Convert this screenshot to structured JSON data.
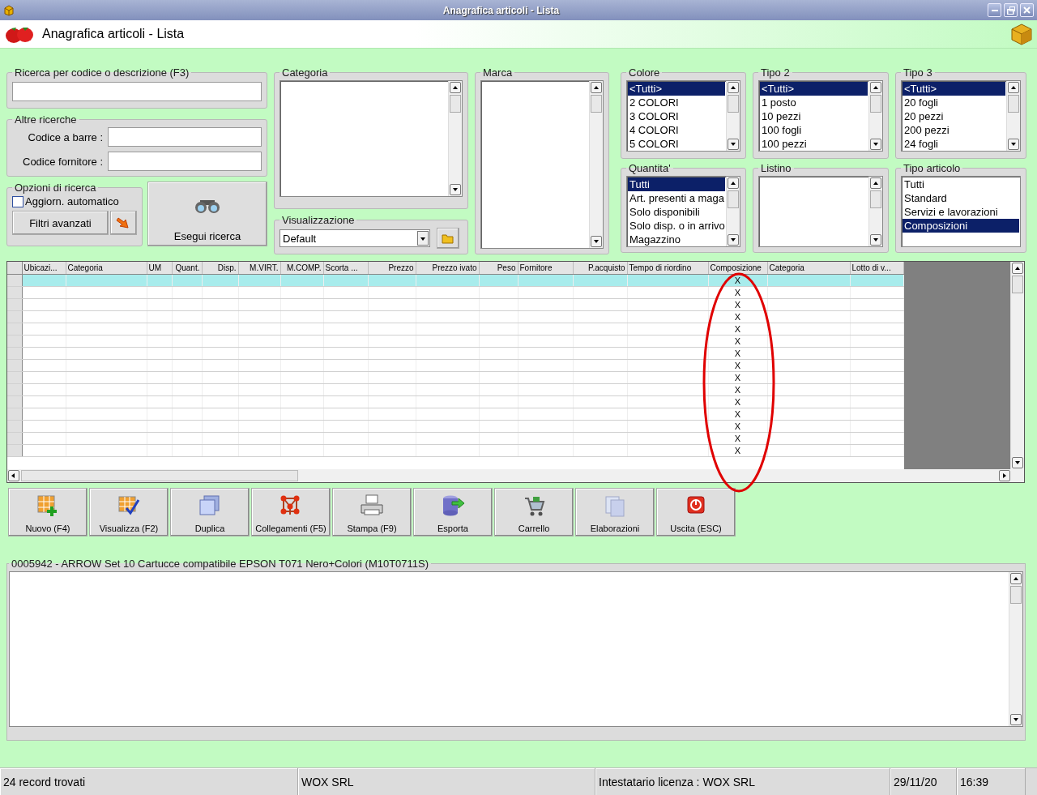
{
  "window": {
    "title": "Anagrafica articoli  - Lista"
  },
  "header": {
    "title": "Anagrafica articoli  - Lista"
  },
  "search": {
    "title": "Ricerca per codice o descrizione (F3)"
  },
  "other_searches": {
    "title": "Altre ricerche",
    "fields": [
      {
        "label": "Codice a barre :"
      },
      {
        "label": "Codice fornitore :"
      }
    ]
  },
  "options": {
    "title": "Opzioni di ricerca",
    "auto_update": {
      "label": "Aggiorn. automatico",
      "checked": false
    },
    "advanced_filters": "Filtri avanzati"
  },
  "search_button": "Esegui ricerca",
  "categoria": {
    "title": "Categoria"
  },
  "visualizzazione": {
    "title": "Visualizzazione",
    "value": "Default"
  },
  "marca": {
    "title": "Marca"
  },
  "lists": [
    {
      "title": "Colore",
      "kind": "scroll",
      "items": [
        {
          "label": "<Tutti>",
          "selected": true
        },
        {
          "label": "2 COLORI",
          "selected": false
        },
        {
          "label": "3 COLORI",
          "selected": false
        },
        {
          "label": "4 COLORI",
          "selected": false
        },
        {
          "label": "5 COLORI",
          "selected": false
        }
      ]
    },
    {
      "title": "Tipo 2",
      "kind": "scroll",
      "items": [
        {
          "label": "<Tutti>",
          "selected": true
        },
        {
          "label": "1 posto",
          "selected": false
        },
        {
          "label": "10 pezzi",
          "selected": false
        },
        {
          "label": "100 fogli",
          "selected": false
        },
        {
          "label": "100 pezzi",
          "selected": false
        }
      ]
    },
    {
      "title": "Tipo 3",
      "kind": "scroll",
      "items": [
        {
          "label": "<Tutti>",
          "selected": true
        },
        {
          "label": "20 fogli",
          "selected": false
        },
        {
          "label": "20 pezzi",
          "selected": false
        },
        {
          "label": "200 pezzi",
          "selected": false
        },
        {
          "label": "24 fogli",
          "selected": false
        }
      ]
    },
    {
      "title": "Quantita'",
      "kind": "scroll",
      "items": [
        {
          "label": "Tutti",
          "selected": true
        },
        {
          "label": "Art. presenti a maga",
          "selected": false
        },
        {
          "label": "Solo disponibili",
          "selected": false
        },
        {
          "label": "Solo disp. o in arrivo",
          "selected": false
        },
        {
          "label": "Magazzino",
          "selected": false
        }
      ]
    },
    {
      "title": "Listino",
      "kind": "scroll"
    },
    {
      "title": "Tipo articolo",
      "kind": "plain",
      "items": [
        {
          "label": "Tutti",
          "selected": false
        },
        {
          "label": "Standard",
          "selected": false
        },
        {
          "label": "Servizi e lavorazioni",
          "selected": false
        },
        {
          "label": "Composizioni",
          "selected": true
        }
      ]
    }
  ],
  "grid": {
    "columns": [
      "Ubicazi...",
      "Categoria",
      "UM",
      "Quant.",
      "Disp.",
      "M.VIRT.",
      "M.COMP.",
      "Scorta ...",
      "Prezzo",
      "Prezzo ivato",
      "Peso",
      "Fornitore",
      "P.acquisto",
      "Tempo di riordino",
      "Composizione",
      "Categoria",
      "Lotto di v..."
    ],
    "rows": [
      {
        "selected": true,
        "composizione": "X"
      },
      {
        "selected": false,
        "composizione": "X"
      },
      {
        "selected": false,
        "composizione": "X"
      },
      {
        "selected": false,
        "composizione": "X"
      },
      {
        "selected": false,
        "composizione": "X"
      },
      {
        "selected": false,
        "composizione": "X"
      },
      {
        "selected": false,
        "composizione": "X"
      },
      {
        "selected": false,
        "composizione": "X"
      },
      {
        "selected": false,
        "composizione": "X"
      },
      {
        "selected": false,
        "composizione": "X"
      },
      {
        "selected": false,
        "composizione": "X"
      },
      {
        "selected": false,
        "composizione": "X"
      },
      {
        "selected": false,
        "composizione": "X"
      },
      {
        "selected": false,
        "composizione": "X"
      },
      {
        "selected": false,
        "composizione": "X"
      }
    ]
  },
  "annotation": {
    "kind": "ellipse"
  },
  "toolbar": [
    {
      "kind": "new",
      "label": "Nuovo (F4)"
    },
    {
      "kind": "view",
      "label": "Visualizza (F2)"
    },
    {
      "kind": "duplicate",
      "label": "Duplica"
    },
    {
      "kind": "links",
      "label": "Collegamenti (F5)"
    },
    {
      "kind": "print",
      "label": "Stampa (F9)"
    },
    {
      "kind": "export",
      "label": "Esporta"
    },
    {
      "kind": "cart",
      "label": "Carrello"
    },
    {
      "kind": "processing",
      "label": "Elaborazioni"
    },
    {
      "kind": "exit",
      "label": "Uscita (ESC)"
    }
  ],
  "detail": {
    "title": "0005942 - ARROW Set 10 Cartucce compatibile EPSON T071 Nero+Colori (M10T0711S)"
  },
  "status_bar": [
    "24 record trovati",
    "WOX SRL",
    "Intestatario licenza : WOX SRL",
    "29/11/20",
    "16:39"
  ]
}
